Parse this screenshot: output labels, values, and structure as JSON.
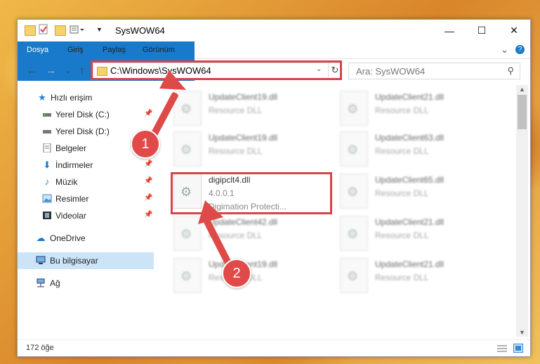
{
  "window": {
    "title": "SysWOW64",
    "minimize_glyph": "—",
    "maximize_glyph": "☐",
    "close_glyph": "✕"
  },
  "ribbon": {
    "tabs": [
      "Dosya",
      "Giriş",
      "Paylaş",
      "Görünüm"
    ],
    "collapse_glyph": "⌄",
    "help_glyph": "?"
  },
  "navigation": {
    "back_glyph": "←",
    "forward_glyph": "→",
    "recent_glyph": "⌄",
    "up_glyph": "↑",
    "address": "C:\\Windows\\SysWOW64",
    "address_dropdown_glyph": "⌄",
    "refresh_glyph": "↻",
    "search_placeholder": "Ara: SysWOW64",
    "search_glyph": "⚲"
  },
  "sidebar": {
    "items": [
      {
        "label": "Hızlı erişim",
        "icon": "star-icon"
      },
      {
        "label": "Yerel Disk (C:)",
        "icon": "drive-icon"
      },
      {
        "label": "Yerel Disk (D:)",
        "icon": "drive-icon"
      },
      {
        "label": "Belgeler",
        "icon": "documents-icon"
      },
      {
        "label": "İndirmeler",
        "icon": "download-icon"
      },
      {
        "label": "Müzik",
        "icon": "music-icon"
      },
      {
        "label": "Resimler",
        "icon": "pictures-icon"
      },
      {
        "label": "Videolar",
        "icon": "video-icon"
      },
      {
        "label": "OneDrive",
        "icon": "cloud-icon"
      },
      {
        "label": "Bu bilgisayar",
        "icon": "computer-icon"
      },
      {
        "label": "Ağ",
        "icon": "network-icon"
      }
    ]
  },
  "files": [
    {
      "name": "UpdateClient19.dll",
      "desc": "Resource DLL"
    },
    {
      "name": "UpdateClient21.dll",
      "desc": "Resource DLL"
    },
    {
      "name": "UpdateClient19.dll",
      "desc": "Resource DLL"
    },
    {
      "name": "UpdateClient63.dll",
      "desc": "Resource DLL"
    },
    {
      "name": "digipclt4.dll",
      "version": "4.0.0.1",
      "desc": "Digimation Protecti..."
    },
    {
      "name": "UpdateClient65.dll",
      "desc": "Resource DLL"
    },
    {
      "name": "UpdateClient42.dll",
      "desc": "Resource DLL"
    },
    {
      "name": "UpdateClient21.dll",
      "desc": "Resource DLL"
    },
    {
      "name": "UpdateClient19.dll",
      "desc": "Resource DLL"
    },
    {
      "name": "UpdateClient21.dll",
      "desc": "Resource DLL"
    }
  ],
  "status": {
    "item_count": "172 öğe"
  },
  "annotations": {
    "step1": "1",
    "step2": "2"
  },
  "colors": {
    "accent": "#1979ca",
    "highlight": "#d8424a",
    "selection": "#cce4f7"
  }
}
